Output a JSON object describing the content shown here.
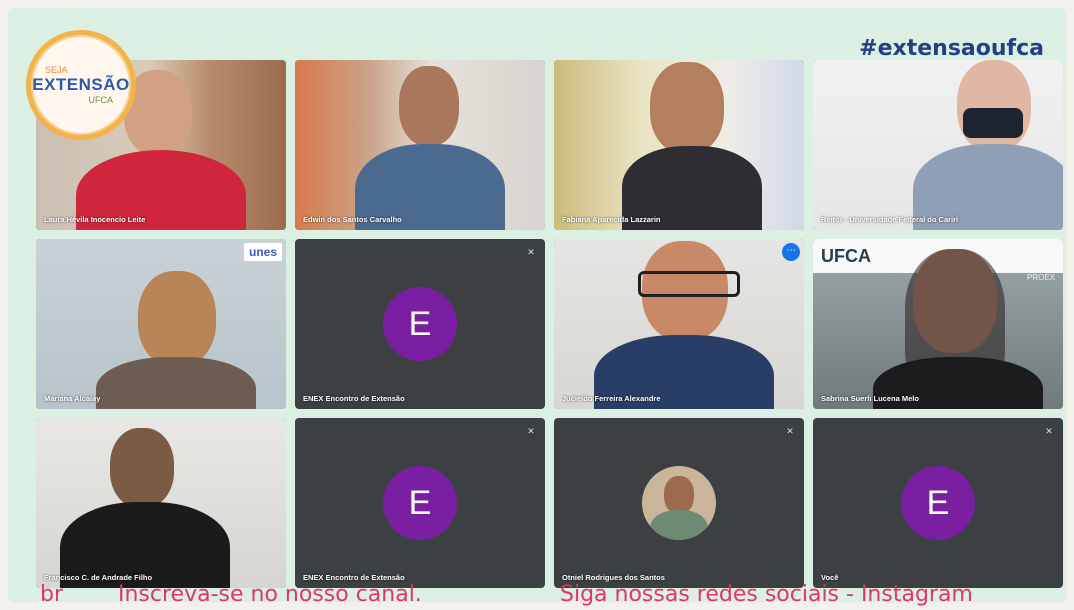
{
  "hashtag": "#extensaoufca",
  "logo": {
    "line1": "SEJA",
    "line2": "EXTENSÃO",
    "line3": "UFCA"
  },
  "tiles": [
    {
      "name": "Laura Hévila Inocencio Leite"
    },
    {
      "name": "Edwin dos Santos Carvalho"
    },
    {
      "name": "Fabiana Aparecida Lazzarin"
    },
    {
      "name": "Reitor - Universidade Federal do Cariri"
    },
    {
      "name": "Mariana Alcalay",
      "badge": "unes"
    },
    {
      "name": "ENEX Encontro de Extensão",
      "letter": "E"
    },
    {
      "name": "Jucieldo Ferreira Alexandre"
    },
    {
      "name": "Sabrina Suerli Lucena Melo",
      "banner": "UFCA",
      "banner2": "PROEX"
    },
    {
      "name": "Francisco C. de Andrade Filho"
    },
    {
      "name": "ENEX Encontro de Extensão",
      "letter": "E"
    },
    {
      "name": "Otniel Rodrigues dos Santos"
    },
    {
      "name": "Você",
      "letter": "E"
    }
  ],
  "ticker": {
    "part1": "br",
    "part2": "Inscreva-se no nosso canal.",
    "part3": "Siga nossas redes sociais - Instagram"
  },
  "colors": {
    "background": "#dcefe3",
    "accent": "#243f86",
    "ticker": "#e2356a",
    "avatar": "#7a1fa2"
  },
  "icons": {
    "mute": "mic-off-icon",
    "more": "more-options-icon"
  }
}
